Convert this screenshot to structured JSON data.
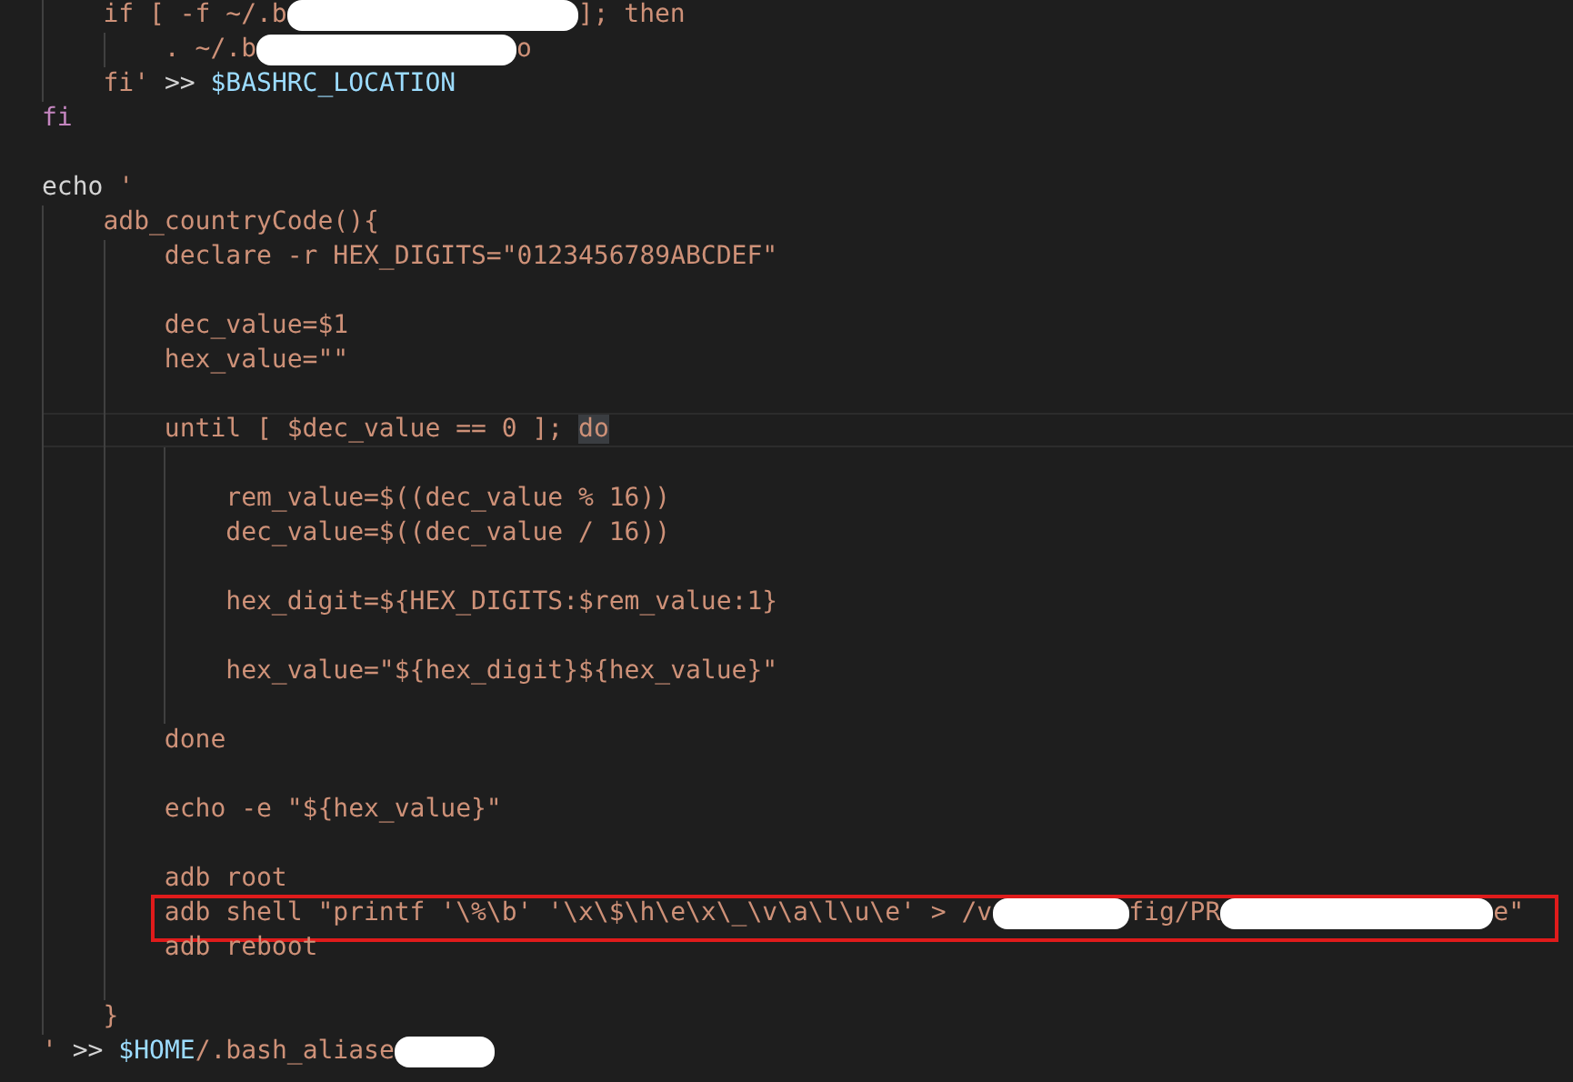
{
  "editor": {
    "lines": [
      {
        "current": false,
        "boxed": false,
        "segments": [
          {
            "kind": "string",
            "text": "    if [ -f ~/.b"
          },
          {
            "kind": "redaction"
          },
          {
            "kind": "string",
            "text": "]; then"
          }
        ]
      },
      {
        "current": false,
        "boxed": false,
        "segments": [
          {
            "kind": "string",
            "text": "        . ~/.b"
          },
          {
            "kind": "redaction"
          },
          {
            "kind": "string",
            "text": "o"
          }
        ]
      },
      {
        "current": false,
        "boxed": false,
        "segments": [
          {
            "kind": "string",
            "text": "    fi'"
          },
          {
            "kind": "plain",
            "text": " >> "
          },
          {
            "kind": "variable",
            "text": "$BASHRC_LOCATION"
          }
        ]
      },
      {
        "current": false,
        "boxed": false,
        "segments": [
          {
            "kind": "keyword",
            "text": "fi"
          }
        ]
      },
      {
        "current": false,
        "boxed": false
      },
      {
        "current": false,
        "boxed": false,
        "segments": [
          {
            "kind": "plain",
            "text": "echo"
          },
          {
            "kind": "string",
            "text": " '"
          }
        ]
      },
      {
        "current": false,
        "boxed": false,
        "segments": [
          {
            "kind": "string",
            "text": "    adb_countryCode(){"
          }
        ]
      },
      {
        "current": false,
        "boxed": false,
        "segments": [
          {
            "kind": "string",
            "text": "        declare -r HEX_DIGITS=\"0123456789ABCDEF\""
          }
        ]
      },
      {
        "current": false,
        "boxed": false
      },
      {
        "current": false,
        "boxed": false,
        "segments": [
          {
            "kind": "string",
            "text": "        dec_value=$1"
          }
        ]
      },
      {
        "current": false,
        "boxed": false,
        "segments": [
          {
            "kind": "string",
            "text": "        hex_value=\"\""
          }
        ]
      },
      {
        "current": false,
        "boxed": false
      },
      {
        "current": true,
        "boxed": false,
        "segments": [
          {
            "kind": "string",
            "text": "        until [ $dec_value == 0 ]; "
          },
          {
            "kind": "match",
            "text": "do"
          }
        ]
      },
      {
        "current": false,
        "boxed": false
      },
      {
        "current": false,
        "boxed": false,
        "segments": [
          {
            "kind": "string",
            "text": "            rem_value=$((dec_value % 16))"
          }
        ]
      },
      {
        "current": false,
        "boxed": false,
        "segments": [
          {
            "kind": "string",
            "text": "            dec_value=$((dec_value / 16))"
          }
        ]
      },
      {
        "current": false,
        "boxed": false
      },
      {
        "current": false,
        "boxed": false,
        "segments": [
          {
            "kind": "string",
            "text": "            hex_digit=${HEX_DIGITS:$rem_value:1}"
          }
        ]
      },
      {
        "current": false,
        "boxed": false
      },
      {
        "current": false,
        "boxed": false,
        "segments": [
          {
            "kind": "string",
            "text": "            hex_value=\"${hex_digit}${hex_value}\""
          }
        ]
      },
      {
        "current": false,
        "boxed": false
      },
      {
        "current": false,
        "boxed": false,
        "segments": [
          {
            "kind": "string",
            "text": "        done"
          }
        ]
      },
      {
        "current": false,
        "boxed": false
      },
      {
        "current": false,
        "boxed": false,
        "segments": [
          {
            "kind": "string",
            "text": "        echo -e \"${hex_value}\""
          }
        ]
      },
      {
        "current": false,
        "boxed": false
      },
      {
        "current": false,
        "boxed": false,
        "segments": [
          {
            "kind": "string",
            "text": "        adb root"
          }
        ]
      },
      {
        "current": false,
        "boxed": true,
        "segments": [
          {
            "kind": "string",
            "text": "        adb shell \"printf '\\%\\b' '\\x\\$\\h\\e\\x\\_\\v\\a\\l\\u\\e' > /v"
          },
          {
            "kind": "redaction"
          },
          {
            "kind": "string",
            "text": "fig/PR"
          },
          {
            "kind": "redaction"
          },
          {
            "kind": "string",
            "text": "e\""
          }
        ]
      },
      {
        "current": false,
        "boxed": false,
        "segments": [
          {
            "kind": "string",
            "text": "        adb reboot"
          }
        ]
      },
      {
        "current": false,
        "boxed": false
      },
      {
        "current": false,
        "boxed": false,
        "segments": [
          {
            "kind": "string",
            "text": "    }"
          }
        ]
      },
      {
        "current": false,
        "boxed": false,
        "segments": [
          {
            "kind": "string",
            "text": "'"
          },
          {
            "kind": "plain",
            "text": " >> "
          },
          {
            "kind": "variable",
            "text": "$HOME"
          },
          {
            "kind": "string",
            "text": "/.bash_aliase"
          },
          {
            "kind": "redaction"
          }
        ]
      }
    ]
  }
}
